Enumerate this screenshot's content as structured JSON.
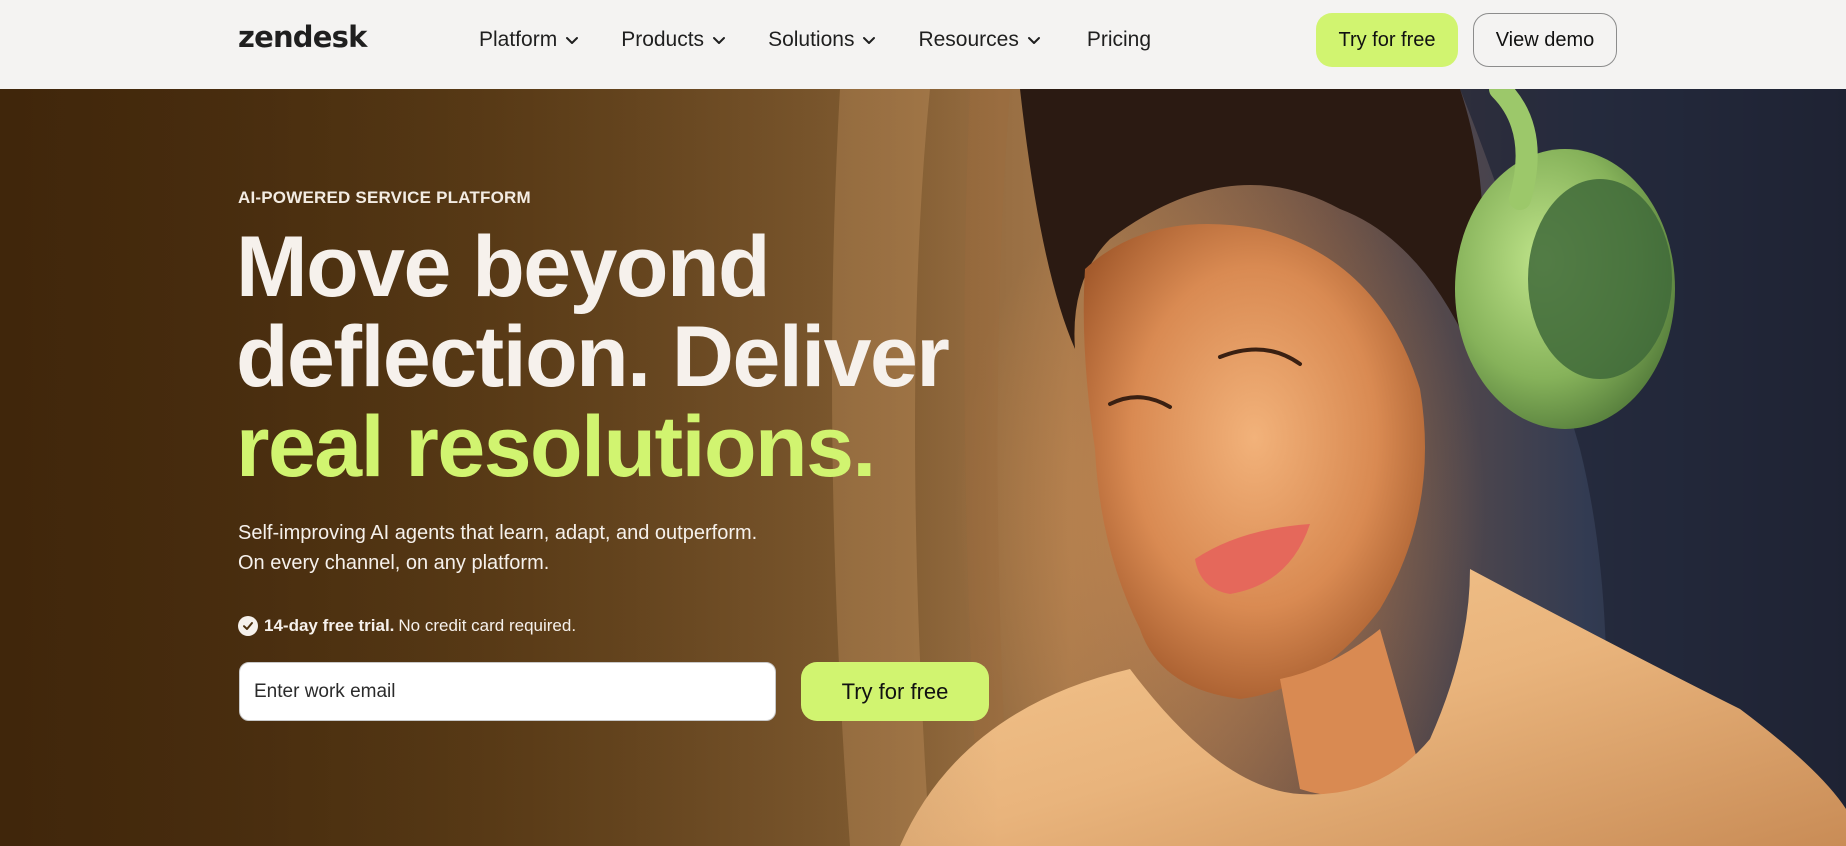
{
  "header": {
    "logo": "zendesk",
    "nav": [
      {
        "label": "Platform",
        "icon": "chevron-down-icon"
      },
      {
        "label": "Products",
        "icon": "chevron-down-icon"
      },
      {
        "label": "Solutions",
        "icon": "chevron-down-icon"
      },
      {
        "label": "Resources",
        "icon": "chevron-down-icon"
      },
      {
        "label": "Pricing"
      }
    ],
    "try_label": "Try for free",
    "demo_label": "View demo"
  },
  "hero": {
    "eyebrow": "AI-POWERED SERVICE PLATFORM",
    "headline_line1": "Move beyond",
    "headline_line2": "deflection. Deliver",
    "headline_accent": "real resolutions.",
    "subtext_line1": "Self-improving AI agents that learn, adapt, and outperform.",
    "subtext_line2": "On every channel, on any platform.",
    "trial_bold": "14-day free trial.",
    "trial_rest": "No credit card required.",
    "email_placeholder": "Enter work email",
    "cta_label": "Try for free",
    "image": "woman-with-green-headphones-photo"
  },
  "colors": {
    "accent": "#d1f470",
    "header_bg": "#f4f3f2",
    "hero_text": "#f6f1ec"
  }
}
